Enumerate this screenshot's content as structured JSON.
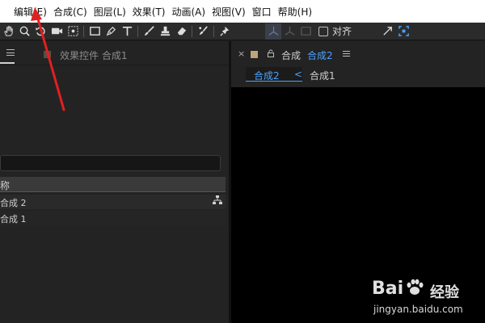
{
  "menubar": {
    "items": [
      "编辑(E)",
      "合成(C)",
      "图层(L)",
      "效果(T)",
      "动画(A)",
      "视图(V)",
      "窗口",
      "帮助(H)"
    ]
  },
  "toolbar": {
    "snap_label": "对齐"
  },
  "left_panel": {
    "effects_tab": "效果控件 合成1",
    "column_header": "称",
    "rows": [
      "合成 2",
      "合成 1"
    ]
  },
  "right_panel": {
    "tab_prefix": "合成",
    "tab_active": "合成2",
    "breadcrumb_active": "合成2",
    "breadcrumb_chevron": "<",
    "breadcrumb_other": "合成1",
    "close_glyph": "×"
  },
  "watermark": {
    "brand": "Bai",
    "brand_suffix": "经验",
    "url": "jingyan.baidu.com"
  },
  "annotation": {
    "arrow_color": "#e02020"
  }
}
